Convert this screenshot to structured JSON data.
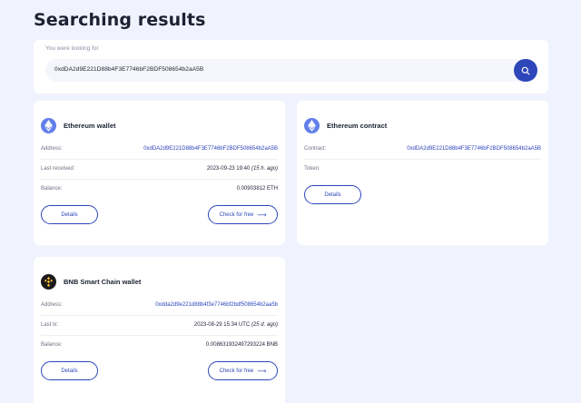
{
  "page": {
    "title": "Searching results"
  },
  "search": {
    "caption": "You were looking for",
    "value": "0xdDA2d9E221D88b4F3E7746bF2BDF508654b2aA5B"
  },
  "eth_wallet": {
    "title": "Ethereum wallet",
    "icon": "ethereum-icon",
    "rows": [
      {
        "label": "Address:",
        "value": "0xdDA2d9E221D88b4F3E7746bF2BDF508654b2aA5B"
      },
      {
        "label": "Last received:",
        "value": "2023-09-23 19:40",
        "note": "(15 h. ago)"
      },
      {
        "label": "Balance:",
        "value": "0.00903812 ETH"
      }
    ],
    "details_label": "Details",
    "check_label": "Check for free"
  },
  "eth_contract": {
    "title": "Ethereum contract",
    "icon": "ethereum-icon",
    "rows": [
      {
        "label": "Contract:",
        "value": "0xdDA2d9E221D88b4F3E7746bF2BDF508654b2aA5B"
      },
      {
        "label": "Token:",
        "value": ""
      }
    ],
    "details_label": "Details"
  },
  "bnb_wallet": {
    "title": "BNB Smart Chain wallet",
    "icon": "bnb-icon",
    "rows": [
      {
        "label": "Address:",
        "value": "0xdda2d9e221d88b4f3e7746bf2bdf508654b2aa5b"
      },
      {
        "label": "Last tx:",
        "value": "2023-08-29 15:34 UTC",
        "note": "(25 d. ago)"
      },
      {
        "label": "Balance:",
        "value": "0.008631932497293224 BNB"
      }
    ],
    "details_label": "Details",
    "check_label": "Check for free"
  },
  "colors": {
    "accent": "#2d46b9",
    "background": "#f0f3fd",
    "eth": "#627eea"
  }
}
